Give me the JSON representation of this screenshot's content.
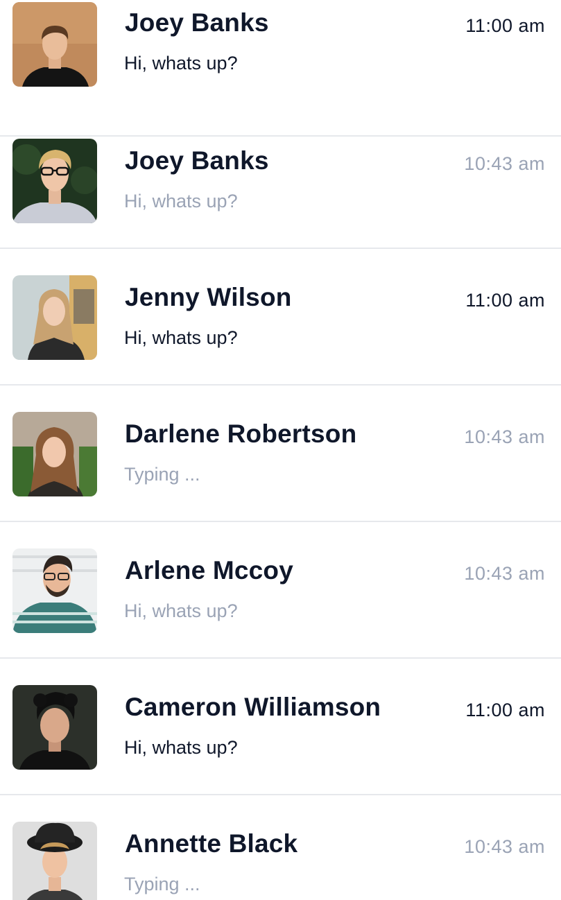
{
  "chats": [
    {
      "name": "Joey Banks",
      "message": "Hi, whats up?",
      "time": "11:00 am",
      "unread": true
    },
    {
      "name": "Joey Banks",
      "message": "Hi, whats up?",
      "time": "10:43 am",
      "unread": false
    },
    {
      "name": "Jenny Wilson",
      "message": "Hi, whats up?",
      "time": "11:00 am",
      "unread": true
    },
    {
      "name": "Darlene Robertson",
      "message": "Typing ...",
      "time": "10:43 am",
      "unread": false
    },
    {
      "name": "Arlene Mccoy",
      "message": "Hi, whats up?",
      "time": "10:43 am",
      "unread": false
    },
    {
      "name": "Cameron Williamson",
      "message": "Hi, whats up?",
      "time": "11:00 am",
      "unread": true
    },
    {
      "name": "Annette Black",
      "message": "Typing ...",
      "time": "10:43 am",
      "unread": false
    }
  ],
  "colors": {
    "text_primary": "#0f172a",
    "text_muted": "#9aa3b5",
    "divider": "#e6e8ec"
  }
}
